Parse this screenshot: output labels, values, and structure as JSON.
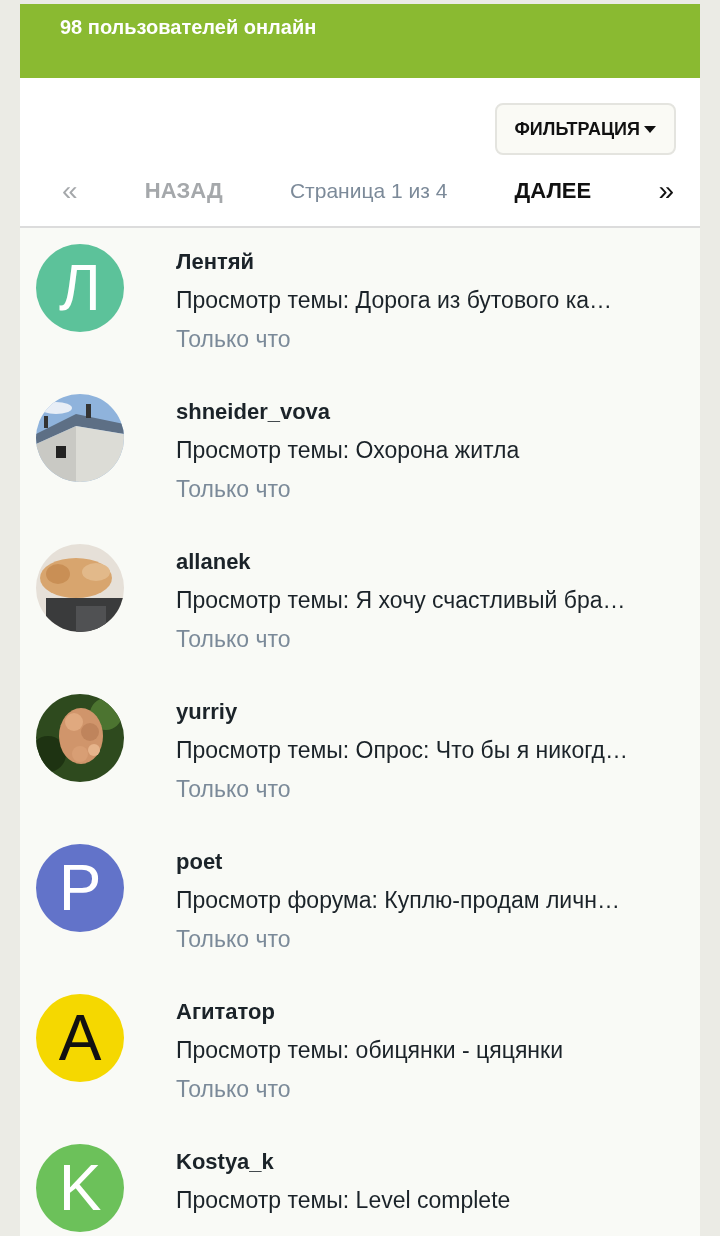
{
  "header": {
    "title": "98 пользователей онлайн"
  },
  "filter_button": {
    "label": "ФИЛЬТРАЦИЯ"
  },
  "pagination": {
    "first": {
      "label": "«",
      "disabled": true
    },
    "prev": {
      "label": "НАЗАД",
      "disabled": true
    },
    "page_info": "Страница 1 из 4",
    "next": {
      "label": "ДАЛЕЕ",
      "disabled": false
    },
    "last": {
      "label": "»",
      "disabled": false
    }
  },
  "users": [
    {
      "name": "Лентяй",
      "activity": "Просмотр темы: Дорога из бутового ка…",
      "time": "Только что",
      "avatar": {
        "kind": "letter",
        "letter": "Л",
        "color": "#5cc29a"
      }
    },
    {
      "name": "shneider_vova",
      "activity": "Просмотр темы: Охорона житла",
      "time": "Только что"
    },
    {
      "name": "allanek",
      "activity": "Просмотр темы: Я хочу счастливый бра…",
      "time": "Только что"
    },
    {
      "name": "yurriy",
      "activity": "Просмотр темы: Опрос: Что бы я никогд…",
      "time": "Только что"
    },
    {
      "name": "poet",
      "activity": "Просмотр форума: Куплю-продам личн…",
      "time": "Только что",
      "avatar": {
        "kind": "letter",
        "letter": "P",
        "color": "#6273c9"
      }
    },
    {
      "name": "Агитатор",
      "activity": "Просмотр темы: обицянки - цяцянки",
      "time": "Только что",
      "avatar": {
        "kind": "letter",
        "letter": "A",
        "color": "#f5d800"
      }
    },
    {
      "name": "Kostya_k",
      "activity": "Просмотр темы: Level complete",
      "avatar": {
        "kind": "letter",
        "letter": "K",
        "color": "#6cc15a"
      }
    }
  ]
}
